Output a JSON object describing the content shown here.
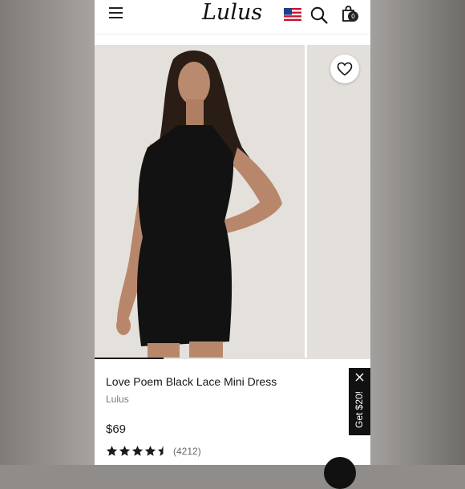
{
  "header": {
    "logo_text": "Lulus",
    "icons": [
      "menu-icon",
      "us-flag-icon",
      "search-icon",
      "shopping-bag-icon"
    ],
    "cart_count": "0"
  },
  "gallery": {
    "images": [
      "model wearing black lace mini dress",
      "next product image (partially visible)"
    ],
    "progress": 0.25,
    "wishlist_icon": "heart-outline-icon"
  },
  "product": {
    "name": "Love Poem Black Lace Mini Dress",
    "brand": "Lulus",
    "price": "$69",
    "rating": 4.5,
    "review_count": "(4212)"
  },
  "promo": {
    "label": "Get $20!",
    "close_icon": "close-icon"
  },
  "colors": {
    "header_bg": "#ffffff",
    "text": "#161616",
    "promo_bg": "#111111",
    "star": "#1a1a1a"
  }
}
